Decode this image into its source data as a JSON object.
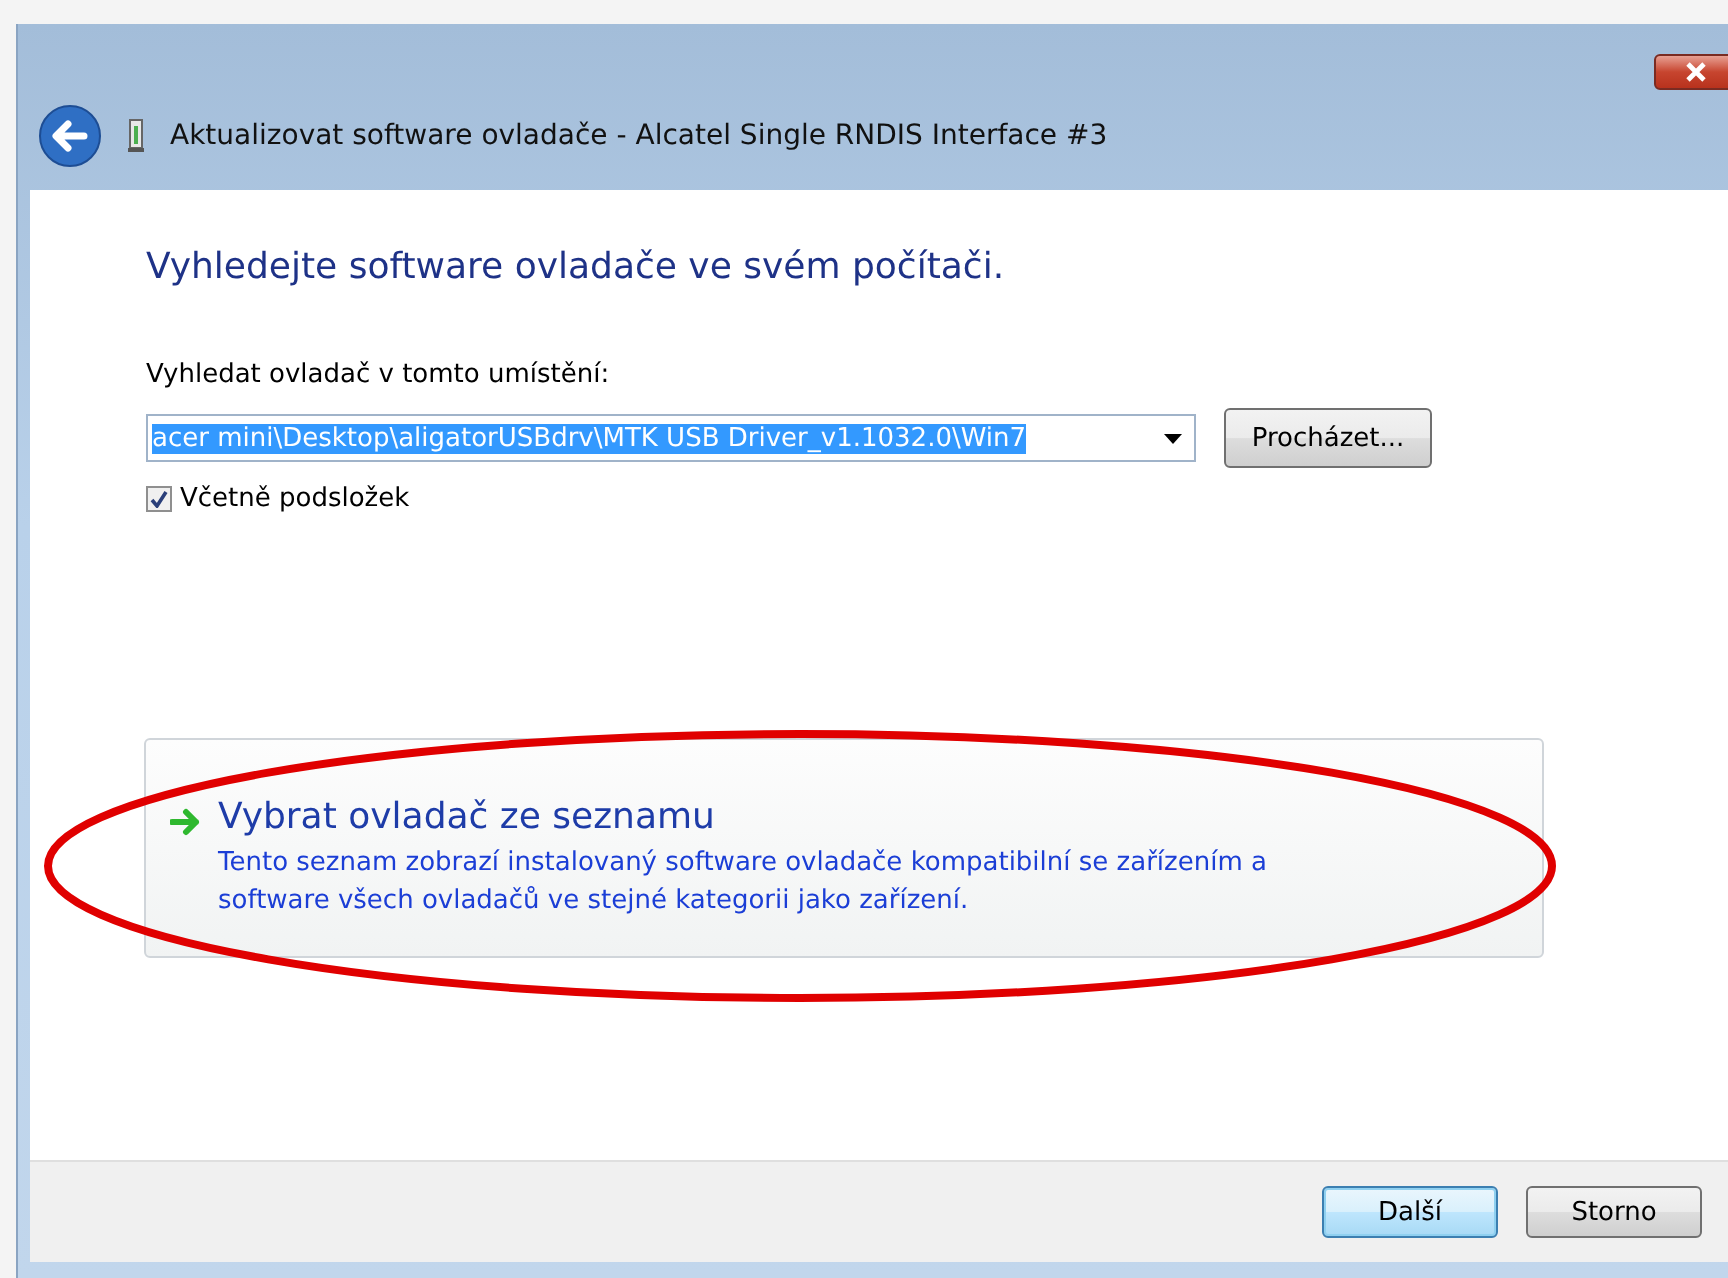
{
  "window": {
    "title": "Aktualizovat software ovladače - Alcatel Single RNDIS Interface #3"
  },
  "heading": "Vyhledejte software ovladače ve svém počítači.",
  "location": {
    "label": "Vyhledat ovladač v tomto umístění:",
    "value": "acer mini\\Desktop\\aligatorUSBdrv\\MTK USB Driver_v1.1032.0\\Win7",
    "value_selected": true,
    "browse_button": "Procházet..."
  },
  "include_subfolders": {
    "label": "Včetně podsložek",
    "checked": true
  },
  "option": {
    "title": "Vybrat ovladač ze seznamu",
    "description": "Tento seznam zobrazí instalovaný software ovladače kompatibilní se zařízením a software všech ovladačů ve stejné kategorii jako zařízení."
  },
  "buttons": [
    {
      "label": "Další",
      "selected": true
    },
    {
      "label": "Storno",
      "selected": false
    }
  ]
}
